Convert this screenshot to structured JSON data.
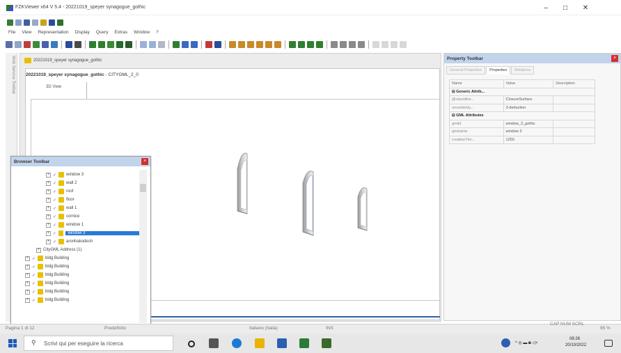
{
  "window": {
    "title": "FZKViewer x64 V 5.4 - 20221019_speyer synagogue_gothic"
  },
  "menu": [
    "File",
    "View",
    "Representation",
    "Display",
    "Query",
    "Extras",
    "Window",
    "?"
  ],
  "left_strip": {
    "label": "Web Service Toolbar"
  },
  "document": {
    "tab_label": "20221019_speyer synagogue_gothic",
    "view_heading_bold": "20221019_speyer synagogue_gothic",
    "view_heading_rest": " - CITYGML_2_0",
    "view_tab": "3D View"
  },
  "property_toolbar": {
    "title": "Property Toolbar",
    "tabs": [
      "General Properties",
      "Properties",
      "Relations"
    ],
    "active_tab": "Properties",
    "columns": [
      "Name",
      "Value",
      "Description"
    ],
    "groups": [
      {
        "name": "Generic Attrib...",
        "rows": [
          {
            "name": "@cityeditor...",
            "value": "ClosureSurface",
            "description": ""
          },
          {
            "name": "uncertainty...",
            "value": "3-deduction",
            "description": ""
          }
        ]
      },
      {
        "name": "GML Attributes",
        "rows": [
          {
            "name": "gmlid",
            "value": "window_3_gothic",
            "description": ""
          },
          {
            "name": "gmlname",
            "value": "window 3",
            "description": ""
          },
          {
            "name": "creationTim...",
            "value": "1250",
            "description": ""
          }
        ]
      }
    ]
  },
  "browser": {
    "title": "Browser Toolbar",
    "items": [
      {
        "label": "window 3",
        "level": 1,
        "selected": false
      },
      {
        "label": "wall 2",
        "level": 1,
        "selected": false
      },
      {
        "label": "roof",
        "level": 1,
        "selected": false
      },
      {
        "label": "floor",
        "level": 1,
        "selected": false
      },
      {
        "label": "wall 1",
        "level": 1,
        "selected": false
      },
      {
        "label": "cornice",
        "level": 1,
        "selected": false
      },
      {
        "label": "window 1",
        "level": 1,
        "selected": false
      },
      {
        "label": "window 3",
        "level": 1,
        "selected": true
      },
      {
        "label": "aronhakodesh",
        "level": 1,
        "selected": false
      }
    ],
    "address_label": "CityGML Address (1)",
    "buildings": [
      "bldg:Building",
      "bldg:Building",
      "bldg:Building",
      "bldg:Building",
      "bldg:Building",
      "bldg:Building"
    ]
  },
  "status_bar": {
    "page": "Pagina 1 di 12",
    "mode": "Predefinito",
    "language": "Italiano (Italia)",
    "ins": "INS",
    "scale": "CAP NUM SCRL",
    "zoom": "95 %"
  },
  "taskbar": {
    "search_placeholder": "Scrivi qui per eseguire la ricerca",
    "time": "08:26",
    "date": "20/10/2022"
  },
  "colors": {
    "title_bar_panel": "#c2d4ec",
    "selection": "#2a7ad6",
    "folder": "#e8c000",
    "close": "#d4302c"
  }
}
